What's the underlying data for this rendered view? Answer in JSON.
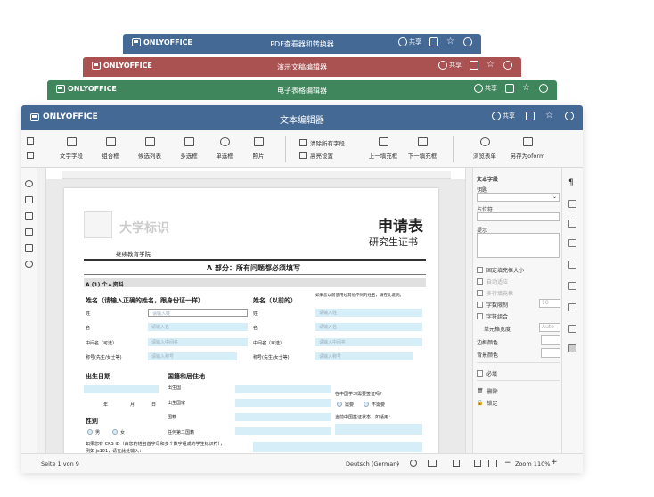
{
  "brand": "ONLYOFFICE",
  "windows": {
    "pdf": {
      "title": "PDF查看器和转换器",
      "share": "共享",
      "color": "#446995"
    },
    "presentation": {
      "title": "演示文稿编辑器",
      "share": "共享",
      "color": "#aa5252"
    },
    "spreadsheet": {
      "title": "电子表格编辑器",
      "share": "共享",
      "color": "#40865c"
    },
    "document": {
      "title": "文本编辑器",
      "share": "共享",
      "color": "#446995"
    }
  },
  "toolbar": {
    "items": [
      "文字字段",
      "组合框",
      "候选列表",
      "多选框",
      "单选框",
      "照片",
      "上一填充框",
      "下一填充框",
      "浏览表单",
      "另存为oform"
    ],
    "clear_fields": "清除所有字段",
    "highlight": "高亮设置"
  },
  "right_panel": {
    "text_field": "文本字段",
    "key": "钥匙",
    "placeholder": "占位符",
    "tip": "提示",
    "fixed_size": "固定填充框大小",
    "autofit": "自动适应",
    "multiline": "多行填充框",
    "char_limit": "字数限制",
    "char_limit_value": "10",
    "comb": "字符组合",
    "cell_width": "单元格宽度",
    "cell_width_value": "Auto",
    "border_color": "边框颜色",
    "bg_color": "背景颜色",
    "required": "必填",
    "delete": "删除",
    "lock": "锁定"
  },
  "status": {
    "page": "Seite 1 von 9",
    "language": "Deutsch (German)",
    "zoom": "Zoom 110%"
  },
  "doc": {
    "logo_text": "大学标识",
    "title": "申请表",
    "subtitle": "研究生证书",
    "school": "继续教育学院",
    "part_a": "A 部分：所有问题都必须填写",
    "sec1": "A (1) 个人资料",
    "name_label": "姓名（请输入正确的姓名，跟身份证一样）",
    "prev_name": "姓名（以前的）",
    "prev_note": "如果您以前使用过其他不同的姓名，请在此说明。",
    "surname": "姓",
    "given": "名",
    "middle": "中间名（可选）",
    "title_label": "称号(先生/女士等)",
    "surname_ph": "请输入姓",
    "given_ph": "请输入名",
    "middle_ph": "请输入中间名",
    "title_ph": "请输入称号",
    "dob": "出生日期",
    "nationality": "国籍和居住地",
    "birth_country": "出生国",
    "birth_region": "出生国家",
    "nation": "国籍",
    "second_nation": "任何第二国籍",
    "year": "年",
    "month": "月",
    "day": "日",
    "gender": "性别",
    "male": "男",
    "female": "女",
    "visa_q": "在中国学习需要签证吗？",
    "yes": "需要",
    "no": "不需要",
    "visa_status": "当前中国签证状态，如适用：",
    "crs_note": "如果您有 CRS ID（由您的姓名首字母和多个数字组成的学生标识符），",
    "crs_example": "例如 js101，请在此处输入："
  }
}
